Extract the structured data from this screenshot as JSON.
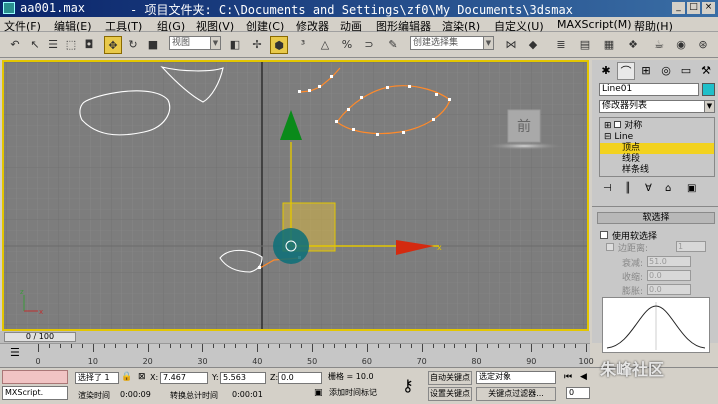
{
  "window": {
    "title": "aa001.max",
    "project": "- 项目文件夹: C:\\Documents and Settings\\zf0\\My Documents\\3dsmax",
    "buttons": [
      "_",
      "□",
      "×"
    ]
  },
  "menu": [
    "文件(F)",
    "编辑(E)",
    "工具(T)",
    "组(G)",
    "视图(V)",
    "创建(C)",
    "修改器",
    "动画",
    "图形编辑器",
    "渲染(R)",
    "自定义(U)",
    "MAXScript(M)",
    "帮助(H)"
  ],
  "toolbar": {
    "view_dropdown": "视图",
    "selection_set": "创建选择集"
  },
  "viewport": {
    "label": "前"
  },
  "panel": {
    "object_name": "Line01",
    "modifier_list": "修改器列表",
    "stack": [
      "对称",
      "Line",
      "顶点",
      "线段",
      "样条线"
    ],
    "soft_rollout": "软选择",
    "use_soft": "使用软选择",
    "edge_distance": "边距离:",
    "edge_value": "1",
    "falloff": "衰减:",
    "falloff_value": "51.0",
    "pinch": "收缩:",
    "pinch_value": "0.0",
    "bubble": "膨胀:",
    "bubble_value": "0.0"
  },
  "timeline": {
    "slider": "0 / 100",
    "ticks": [
      "0",
      "10",
      "20",
      "30",
      "40",
      "50",
      "60",
      "70",
      "80",
      "90",
      "100"
    ]
  },
  "status": {
    "maxscript": "MXScript.",
    "selected": "选择了 1",
    "x_label": "X:",
    "x": "7.467",
    "y_label": "Y:",
    "y": "5.563",
    "z_label": "Z:",
    "z": "0.0",
    "grid": "栅格 = 10.0",
    "render_time_label": "渲染时间",
    "render_time": "0:00:09",
    "conv_time_label": "转换总计时间",
    "conv_time": "0:00:01",
    "add_tag": "添加时间标记",
    "auto_key": "自动关键点",
    "set_key": "设置关键点",
    "selected_obj": "选定对象",
    "key_filter": "关键点过滤器...",
    "frame": "0"
  },
  "watermark": "朱峰社区"
}
